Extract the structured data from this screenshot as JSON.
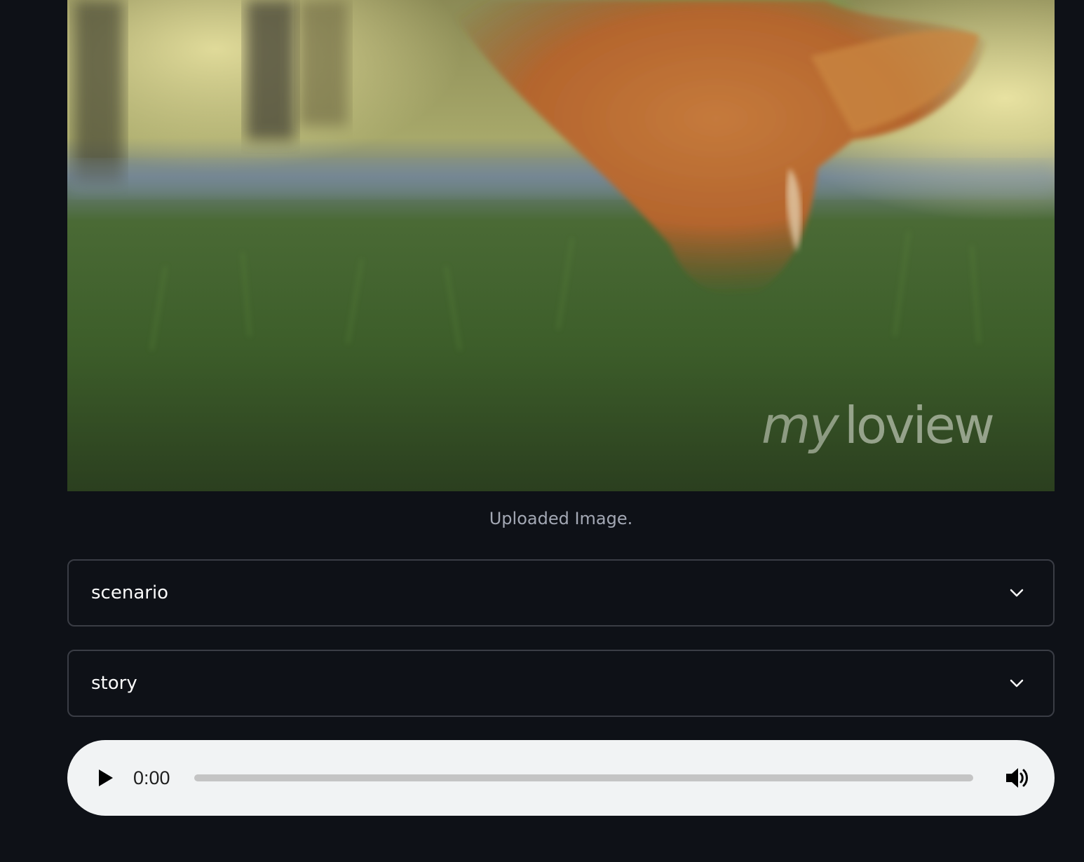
{
  "image": {
    "watermark": "myloview"
  },
  "caption": "Uploaded Image.",
  "expanders": [
    {
      "label": "scenario",
      "icon": "chevron-down-icon"
    },
    {
      "label": "story",
      "icon": "chevron-down-icon"
    }
  ],
  "audio_player": {
    "time": "0:00",
    "progress": 0,
    "play_icon": "play-icon",
    "volume_icon": "volume-icon"
  }
}
